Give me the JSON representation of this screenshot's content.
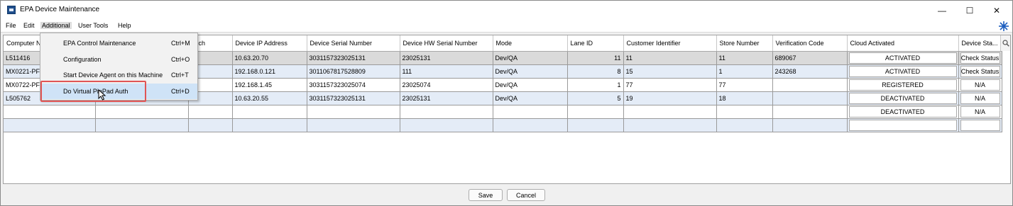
{
  "window": {
    "title": "EPA Device Maintenance"
  },
  "window_controls": {
    "minimize": "—",
    "maximize": "☐",
    "close": "✕"
  },
  "menubar": [
    "File",
    "Edit",
    "Additional",
    "User Tools",
    "Help"
  ],
  "dropdown": [
    {
      "label": "EPA Control Maintenance",
      "shortcut": "Ctrl+M"
    },
    {
      "label": "Configuration",
      "shortcut": "Ctrl+O"
    },
    {
      "label": "Start Device Agent on this Machine",
      "shortcut": "Ctrl+T"
    },
    {
      "label": "Do Virtual PinPad Auth",
      "shortcut": "Ctrl+D"
    }
  ],
  "table": {
    "headers": [
      "Computer N",
      "",
      "anch",
      "Device IP Address",
      "Device Serial Number",
      "Device HW Serial Number",
      "Mode",
      "Lane ID",
      "Customer Identifier",
      "Store Number",
      "Verification Code",
      "Cloud Activated",
      "Device Sta..."
    ],
    "rows": [
      [
        "L511416",
        "",
        "",
        "10.63.20.70",
        "3031157323025131",
        "23025131",
        "Dev/QA",
        "11",
        "11",
        "11",
        "689067",
        "ACTIVATED",
        "Check Status"
      ],
      [
        "MX0221-PF",
        "",
        "",
        "192.168.0.121",
        "3011067817528809",
        "111",
        "Dev/QA",
        "8",
        "15",
        "1",
        "243268",
        "ACTIVATED",
        "Check Status"
      ],
      [
        "MX0722-PF",
        "",
        "",
        "192.168.1.45",
        "3031157323025074",
        "23025074",
        "Dev/QA",
        "1",
        "77",
        "77",
        "",
        "REGISTERED",
        "N/A"
      ],
      [
        "L505762",
        "",
        "",
        "10.63.20.55",
        "3031157323025131",
        "23025131",
        "Dev/QA",
        "5",
        "19",
        "18",
        "",
        "DEACTIVATED",
        "N/A"
      ],
      [
        "",
        "",
        "",
        "",
        "",
        "",
        "",
        "",
        "",
        "",
        "",
        "DEACTIVATED",
        "N/A"
      ],
      [
        "",
        "",
        "",
        "",
        "",
        "",
        "",
        "",
        "",
        "",
        "",
        "",
        ""
      ]
    ]
  },
  "footer": {
    "save": "Save",
    "cancel": "Cancel"
  },
  "colors": {
    "selected_row": "#dadada",
    "alt_row": "#e4ecf7",
    "menu_hover": "#cfe3f7",
    "highlight": "#e05555",
    "star_icon": "#1f5fbf"
  }
}
